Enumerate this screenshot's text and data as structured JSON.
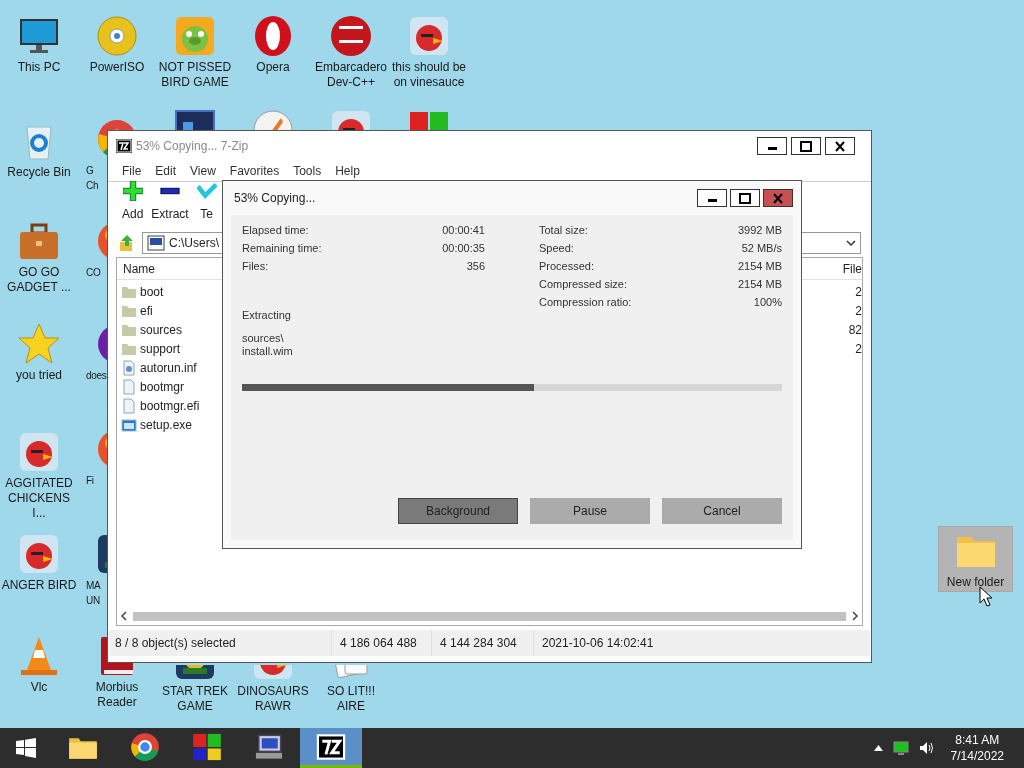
{
  "desktop_icons": [
    {
      "label": "This PC",
      "kind": "monitor",
      "selected": false
    },
    {
      "label": "PowerISO",
      "kind": "disc",
      "selected": false
    },
    {
      "label": "NOT PISSED\nBIRD GAME",
      "kind": "pig",
      "selected": false
    },
    {
      "label": "Opera",
      "kind": "opera",
      "selected": false
    },
    {
      "label": "Embarcadero\nDev-C++",
      "kind": "devcpp",
      "selected": false
    },
    {
      "label": "this should be\non vinesauce",
      "kind": "bird",
      "selected": false
    },
    {
      "label": "Recycle Bin",
      "kind": "recycle",
      "selected": false
    },
    {
      "label": "GO GO\nGADGET ...",
      "kind": "briefcase",
      "selected": false
    },
    {
      "label": "you tried",
      "kind": "star",
      "selected": false
    },
    {
      "label": "AGGITATED\nCHICKENS I...",
      "kind": "bird",
      "selected": false
    },
    {
      "label": "ANGER BIRD",
      "kind": "bird",
      "selected": false
    },
    {
      "label": "Vlc",
      "kind": "cone",
      "selected": false
    },
    {
      "label": "G\nCh",
      "kind": "chrome",
      "selected": false
    },
    {
      "label": "CO",
      "kind": "ball",
      "selected": false
    },
    {
      "label": "does",
      "kind": "purple",
      "selected": false
    },
    {
      "label": "Fi",
      "kind": "ball",
      "selected": false
    },
    {
      "label": "MA\nUN",
      "kind": "dark",
      "selected": false
    },
    {
      "label": "Morbius\nReader",
      "kind": "book",
      "selected": false
    },
    {
      "kind": "ps",
      "selected": false
    },
    {
      "kind": "orange",
      "selected": false
    },
    {
      "kind": "bird",
      "selected": false
    },
    {
      "kind": "blocks",
      "selected": false
    },
    {
      "label": "STAR TREK\nGAME",
      "kind": "dark",
      "selected": false
    },
    {
      "label": "DINOSAURS\nRAWR",
      "kind": "bird",
      "selected": false
    },
    {
      "label": "SO LIT!!! AIRE",
      "kind": "cards",
      "selected": false
    },
    {
      "label": "New folder",
      "kind": "folder",
      "selected": true
    }
  ],
  "main_window": {
    "title": "53% Copying... 7-Zip",
    "menu": [
      "File",
      "Edit",
      "View",
      "Favorites",
      "Tools",
      "Help"
    ],
    "toolbar": [
      {
        "label": "Add",
        "kind": "add"
      },
      {
        "label": "Extract",
        "kind": "extract"
      },
      {
        "label": "Te",
        "kind": "test"
      }
    ],
    "path": "C:\\Users\\",
    "columns": [
      "Name",
      "File"
    ],
    "files": [
      {
        "name": "boot",
        "kind": "folder",
        "column_2": "2"
      },
      {
        "name": "efi",
        "kind": "folder",
        "column_2": "2"
      },
      {
        "name": "sources",
        "kind": "folder",
        "column_2": "82"
      },
      {
        "name": "support",
        "kind": "folder",
        "column_2": "2"
      },
      {
        "name": "autorun.inf",
        "kind": "config"
      },
      {
        "name": "bootmgr",
        "kind": "file"
      },
      {
        "name": "bootmgr.efi",
        "kind": "file"
      },
      {
        "name": "setup.exe",
        "kind": "app"
      }
    ],
    "status_bar": [
      "8 / 8 object(s) selected",
      "4 186 064 488",
      "4 144 284 304",
      "2021-10-06 14:02:41"
    ]
  },
  "progress_dialog": {
    "title": "53% Copying...",
    "left_stats": [
      {
        "label": "Elapsed time:",
        "value": "00:00:41"
      },
      {
        "label": "Remaining time:",
        "value": "00:00:35"
      },
      {
        "label": "Files:",
        "value": "356"
      }
    ],
    "right_stats": [
      {
        "label": "Total size:",
        "value": "3992 MB"
      },
      {
        "label": "Speed:",
        "value": "52 MB/s"
      },
      {
        "label": "Processed:",
        "value": "2154 MB"
      },
      {
        "label": "Compressed size:",
        "value": "2154 MB"
      },
      {
        "label": "Compression ratio:",
        "value": "100%"
      }
    ],
    "operation": "Extracting",
    "current_file": [
      "sources\\",
      "install.wim"
    ],
    "level": 0.54,
    "buttons": [
      {
        "label": "Background",
        "focused": true
      },
      {
        "label": "Pause",
        "focused": false
      },
      {
        "label": "Cancel",
        "focused": false
      }
    ]
  },
  "taskbar": {
    "apps": [
      {
        "kind": "explorer",
        "active": false
      },
      {
        "kind": "chrome",
        "active": false
      },
      {
        "kind": "blocks",
        "active": false
      },
      {
        "kind": "computer",
        "active": false
      },
      {
        "kind": "sevenzip",
        "active": true
      }
    ],
    "time": "8:41 AM",
    "date": "7/14/2022"
  }
}
